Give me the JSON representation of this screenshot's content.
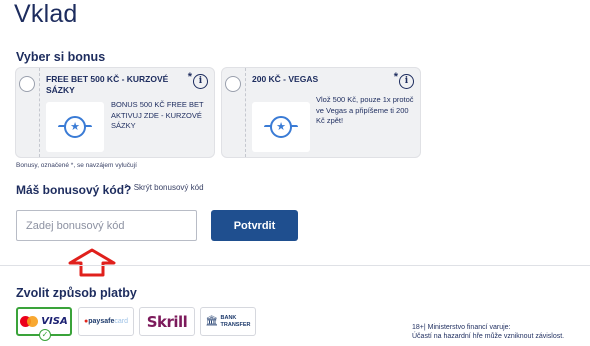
{
  "page": {
    "title": "Vklad"
  },
  "bonus": {
    "label": "Vyber si bonus",
    "cards": [
      {
        "title": "FREE BET 500 KČ - KURZOVÉ SÁZKY",
        "asterisk": "*",
        "info_glyph": "i",
        "badge_icon": "star-badge-icon",
        "description": "BONUS 500 KČ FREE BET AKTIVUJ ZDE - KURZOVÉ SÁZKY"
      },
      {
        "title": "200 KČ - VEGAS",
        "asterisk": "*",
        "info_glyph": "i",
        "badge_icon": "star-badge-icon",
        "description": "Vlož 500 Kč, pouze 1x protoč ve Vegas a připíšeme ti 200 Kč zpět!"
      }
    ],
    "footnote": "Bonusy, označené *, se navzájem vylučují"
  },
  "promo": {
    "question": "Máš bonusový kód?",
    "toggle_icon": "chevron-up-icon",
    "toggle_label": "Skrýt bonusový kód",
    "input_placeholder": "Zadej bonusový kód",
    "input_value": "",
    "confirm_label": "Potvrdit"
  },
  "payment": {
    "label": "Zvolit způsob platby",
    "methods": [
      {
        "id": "card",
        "brand_a": "Mastercard",
        "brand_b": "VISA",
        "selected": true
      },
      {
        "id": "paysafecard",
        "part1": "paysafe",
        "part2": "card",
        "selected": false
      },
      {
        "id": "skrill",
        "label": "Skrill",
        "selected": false
      },
      {
        "id": "bank",
        "line1": "BANK",
        "line2": "TRANSFER",
        "selected": false
      }
    ]
  },
  "legal": {
    "line1": "18+| Ministerstvo financí varuje:",
    "line2": "Účastí na hazardní hře může vzniknout závislost."
  },
  "colors": {
    "primary": "#1d2c5e",
    "button": "#1f4f8f",
    "selected": "#3aa33a",
    "annotation_arrow": "#e0201c"
  }
}
